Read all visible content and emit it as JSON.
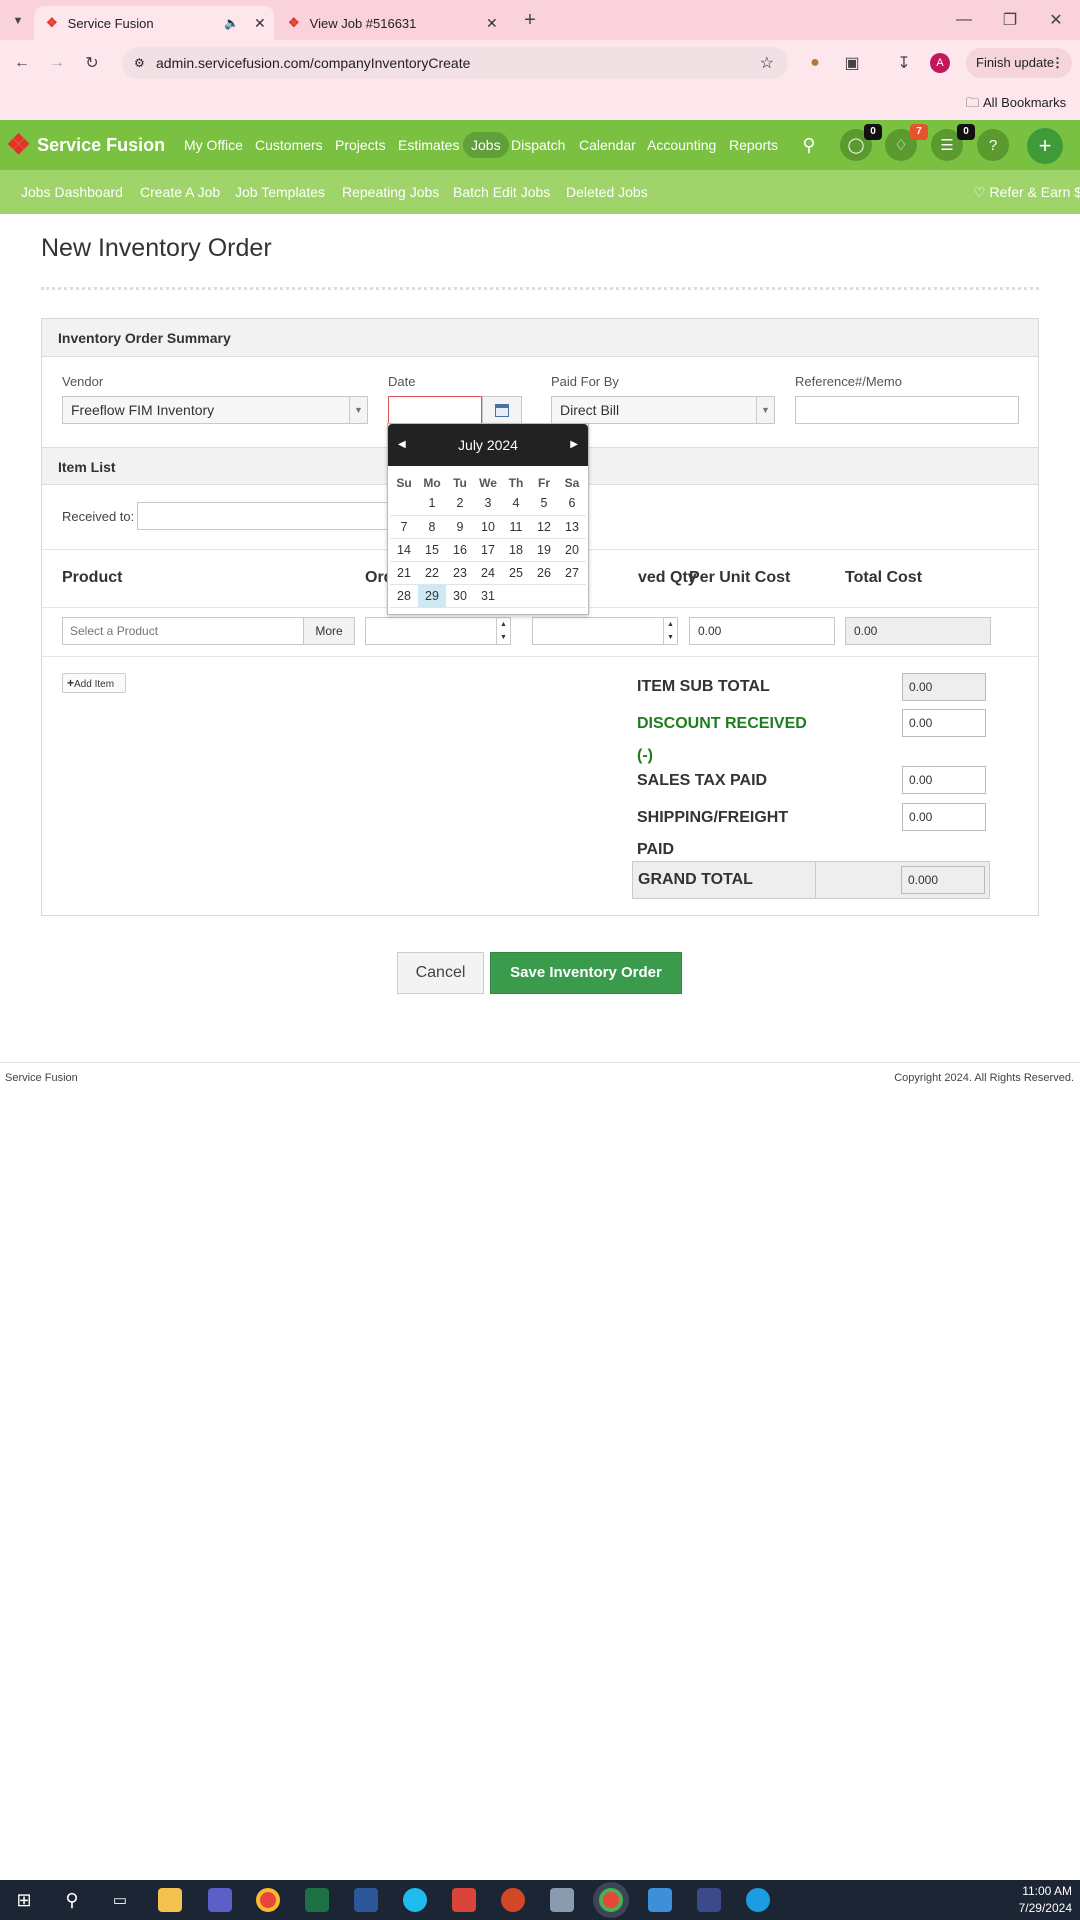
{
  "browser": {
    "tabs": [
      {
        "title": "Service Fusion",
        "active": true
      },
      {
        "title": "View Job #516631",
        "active": false
      }
    ],
    "url": "admin.servicefusion.com/companyInventoryCreate",
    "finish_update_label": "Finish update",
    "all_bookmarks_label": "All Bookmarks",
    "profile_initial": "A"
  },
  "app": {
    "brand": "Service Fusion",
    "main_nav": [
      "My Office",
      "Customers",
      "Projects",
      "Estimates",
      "Jobs",
      "Dispatch",
      "Calendar",
      "Accounting",
      "Reports"
    ],
    "active_nav": "Jobs",
    "badges": {
      "chat": "0",
      "notifications": "7",
      "tasks": "0"
    },
    "sub_nav": [
      "Jobs Dashboard",
      "Create A Job",
      "Job Templates",
      "Repeating Jobs",
      "Batch Edit Jobs",
      "Deleted Jobs"
    ],
    "refer_label": "Refer & Earn $"
  },
  "page": {
    "title": "New Inventory Order",
    "summary_header": "Inventory Order Summary",
    "vendor_label": "Vendor",
    "vendor_value": "Freeflow FIM Inventory",
    "date_label": "Date",
    "date_value": "",
    "paid_label": "Paid For By",
    "paid_value": "Direct Bill",
    "reference_label": "Reference#/Memo",
    "reference_value": "",
    "item_list_header": "Item List",
    "received_to_label": "Received to:",
    "columns": {
      "product": "Product",
      "ordered": "Ord",
      "received": "ved Qty",
      "unit_cost": "Per Unit Cost",
      "total_cost": "Total Cost"
    },
    "product_placeholder": "Select a Product",
    "more_label": "More",
    "unit_cost_value": "0.00",
    "total_cost_value": "0.00",
    "add_item_label": "Add Item",
    "totals": {
      "sub_total_label": "ITEM SUB TOTAL",
      "sub_total_value": "0.00",
      "discount_label": "DISCOUNT RECEIVED",
      "discount_sub": "(-)",
      "discount_value": "0.00",
      "tax_label": "SALES TAX PAID",
      "tax_value": "0.00",
      "shipping_label_1": "SHIPPING/FREIGHT",
      "shipping_label_2": "PAID",
      "shipping_value": "0.00",
      "grand_label": "GRAND TOTAL",
      "grand_value": "0.000"
    },
    "cancel_label": "Cancel",
    "save_label": "Save Inventory Order"
  },
  "calendar": {
    "month_label": "July 2024",
    "weekdays": [
      "Su",
      "Mo",
      "Tu",
      "We",
      "Th",
      "Fr",
      "Sa"
    ],
    "weeks": [
      [
        "",
        "1",
        "2",
        "3",
        "4",
        "5",
        "6"
      ],
      [
        "7",
        "8",
        "9",
        "10",
        "11",
        "12",
        "13"
      ],
      [
        "14",
        "15",
        "16",
        "17",
        "18",
        "19",
        "20"
      ],
      [
        "21",
        "22",
        "23",
        "24",
        "25",
        "26",
        "27"
      ],
      [
        "28",
        "29",
        "30",
        "31",
        "",
        "",
        ""
      ]
    ],
    "highlighted_day": "29"
  },
  "footer": {
    "left": "Service Fusion",
    "right": "Copyright 2024. All Rights Reserved."
  },
  "taskbar": {
    "time": "11:00 AM",
    "date": "7/29/2024"
  },
  "colors": {
    "green": "#7ac142",
    "light_green": "#9fd46a",
    "save_green": "#3a9b4d",
    "discount_green": "#1e7d1e"
  }
}
